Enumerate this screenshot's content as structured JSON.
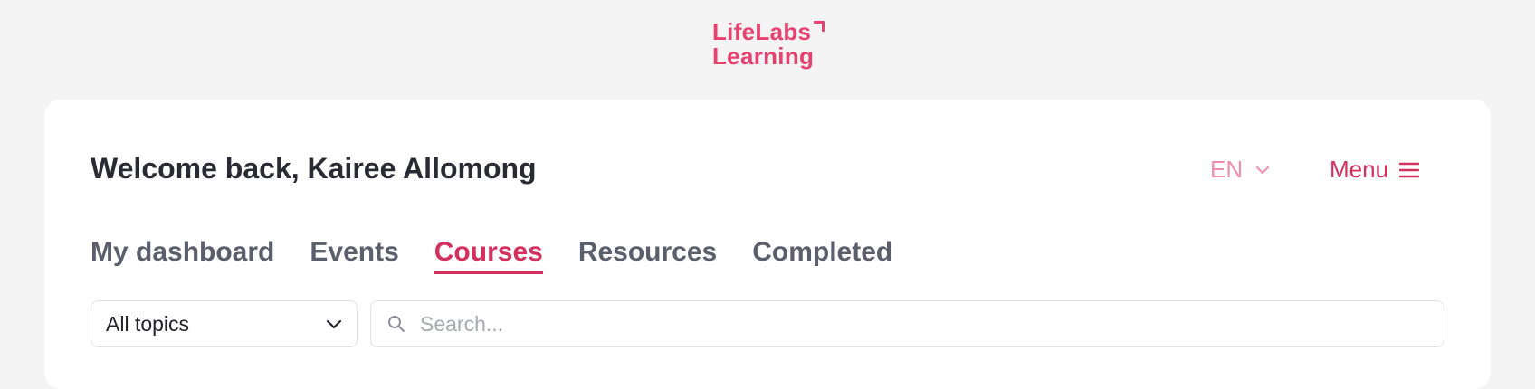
{
  "logo": {
    "line1": "LifeLabs",
    "line2": "Learning",
    "color": "#e8416f"
  },
  "header": {
    "welcome": "Welcome back, Kairee Allomong",
    "language": "EN",
    "menu_label": "Menu",
    "icons": {
      "language_caret": "chevron-down-icon",
      "menu": "hamburger-icon"
    }
  },
  "tabs": [
    {
      "label": "My dashboard",
      "active": false
    },
    {
      "label": "Events",
      "active": false
    },
    {
      "label": "Courses",
      "active": true
    },
    {
      "label": "Resources",
      "active": false
    },
    {
      "label": "Completed",
      "active": false
    }
  ],
  "filters": {
    "topic_selected": "All topics",
    "search_placeholder": "Search...",
    "search_value": ""
  },
  "colors": {
    "accent": "#d4305d",
    "accent_light": "#ee8fa9",
    "background": "#f4f4f4",
    "tab_text": "#5b5f6b"
  }
}
